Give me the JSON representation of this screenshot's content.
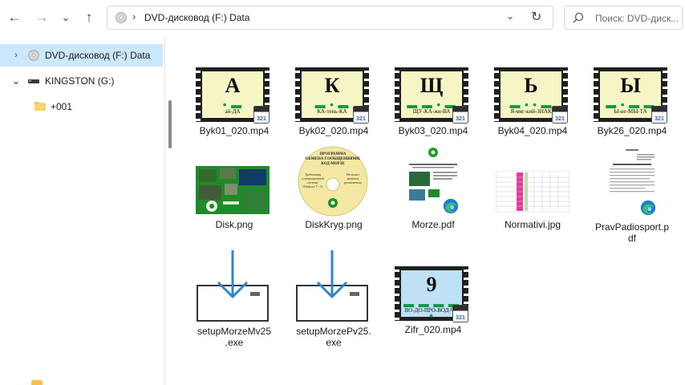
{
  "address": {
    "path": "DVD-дисковод (F:) Data",
    "separator": "›",
    "dropdown": "⌄",
    "refresh": "↻"
  },
  "search": {
    "placeholder": "Поиск: DVD-диск..."
  },
  "nav": {
    "back": "←",
    "forward": "→",
    "recent": "⌄",
    "up": "↑"
  },
  "sidebar": {
    "items": [
      {
        "label": "DVD-дисковод (F:) Data",
        "chevron": "›",
        "selected": true
      },
      {
        "label": "KINGSTON (G:)",
        "chevron": "⌄",
        "selected": false
      },
      {
        "label": "+001",
        "chevron": "",
        "selected": false
      }
    ]
  },
  "files": [
    {
      "name": "Byk01_020.mp4",
      "kind": "video",
      "letter": "А",
      "code": "• ▬",
      "word": "ай-ДА"
    },
    {
      "name": "Byk02_020.mp4",
      "kind": "video",
      "letter": "К",
      "code": "▬ • ▬",
      "word": "КА-тень-КА"
    },
    {
      "name": "Byk03_020.mp4",
      "kind": "video",
      "letter": "Щ",
      "code": "▬ ▬ • ▬",
      "word": "ЩУ-КА-жи-ВА"
    },
    {
      "name": "Byk04_020.mp4",
      "kind": "video",
      "letter": "Ь",
      "code": "▬ • • ▬",
      "word": "Я-мяг-кий-ЗНАК"
    },
    {
      "name": "Byk26_020.mp4",
      "kind": "video",
      "letter": "Ы",
      "code": "▬ • ▬ ▬",
      "word": "Ы-не-МЫ-ТА"
    },
    {
      "name": "Disk.png",
      "kind": "image-disk"
    },
    {
      "name": "DiskKryg.png",
      "kind": "image-cd"
    },
    {
      "name": "Morze.pdf",
      "kind": "pdf"
    },
    {
      "name": "Normativi.jpg",
      "kind": "image-table"
    },
    {
      "name_line1": "PravPadiosport.p",
      "name_line2": "df",
      "kind": "pdf-doc"
    },
    {
      "name_line1": "setupMorzeMv25",
      "name_line2": ".exe",
      "kind": "exe"
    },
    {
      "name_line1": "setupMorzePv25.",
      "name_line2": "exe",
      "kind": "exe"
    },
    {
      "name": "Zifr_020.mp4",
      "kind": "video",
      "letter": "9",
      "code": "▬ ▬ ▬ ▬ •",
      "word": "ВО-ДО-ПРО-ВОД-ЧИ"
    }
  ],
  "cd_text": {
    "title": "ПРОГРАММА ОБМЕНА СООБЩЕНИЯМИ. КОД МОРЗЕ",
    "left": "Требования к операционной системе: Windows 7 - 11",
    "right": "Не может являться регламентом и контролировать действия"
  },
  "badge_text": "321",
  "colors": {
    "selection": "#cce8ff",
    "folder": "#f4c24a",
    "morse_green": "#0a9b3a",
    "exe_arrow": "#2b87d1"
  }
}
